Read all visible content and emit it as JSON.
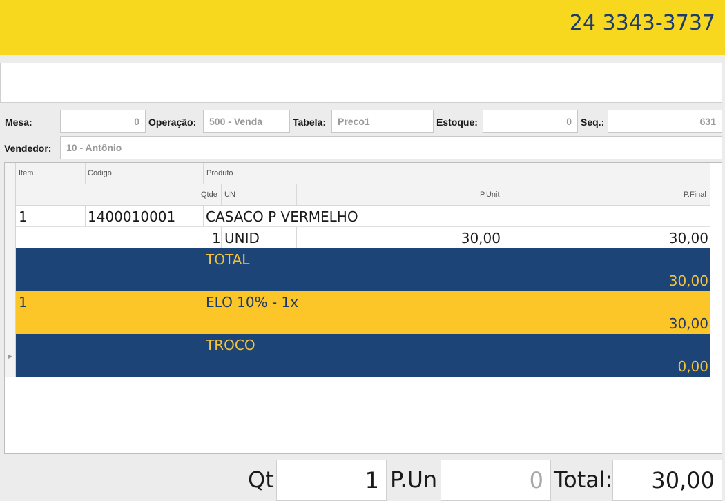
{
  "header": {
    "phone": "24 3343-3737"
  },
  "form": {
    "mesa_label": "Mesa:",
    "mesa_value": "0",
    "operacao_label": "Operação:",
    "operacao_value": "500 - Venda",
    "tabela_label": "Tabela:",
    "tabela_value": "Preco1",
    "estoque_label": "Estoque:",
    "estoque_value": "0",
    "seq_label": "Seq.:",
    "seq_value": "631",
    "vendedor_label": "Vendedor:",
    "vendedor_value": "10 - Antônio"
  },
  "grid": {
    "headers": {
      "item": "Item",
      "codigo": "Código",
      "produto": "Produto",
      "qtde": "Qtde",
      "un": "UN",
      "punit": "P.Unit",
      "pfinal": "P.Final"
    },
    "item_row": {
      "item": "1",
      "codigo": "1400010001",
      "produto": "CASACO P VERMELHO",
      "qtde": "1",
      "un": "UNID",
      "punit": "30,00",
      "pfinal": "30,00"
    },
    "total_row": {
      "label": "TOTAL",
      "value": "30,00"
    },
    "payment_row": {
      "item": "1",
      "label": "ELO 10% - 1x",
      "value": "30,00"
    },
    "troco_row": {
      "label": "TROCO",
      "value": "0,00"
    }
  },
  "bottom": {
    "qt_label": "Qt",
    "qt_value": "1",
    "pun_label": "P.Un",
    "pun_value": "0",
    "total_label": "Total:",
    "total_value": "30,00"
  },
  "colors": {
    "header_bg": "#f8d81f",
    "navy": "#1d4477",
    "gold": "#fcc628",
    "accent_text": "#f5c33b"
  }
}
